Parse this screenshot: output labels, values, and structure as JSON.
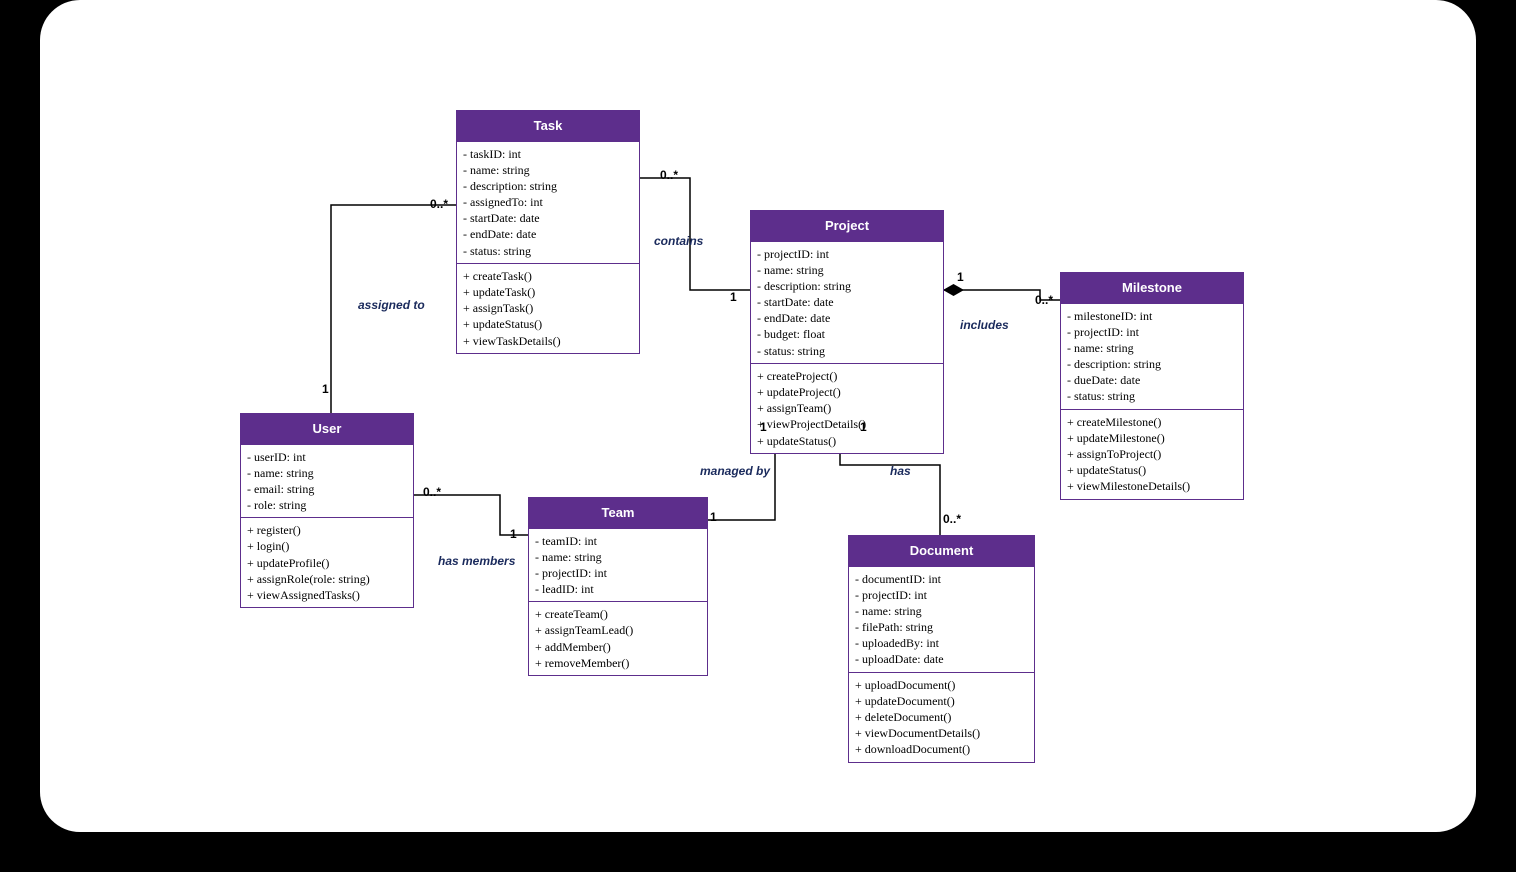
{
  "classes": {
    "task": {
      "title": "Task",
      "attrs": [
        "- taskID: int",
        "- name: string",
        "- description: string",
        "- assignedTo: int",
        "- startDate: date",
        "- endDate: date",
        "- status: string"
      ],
      "ops": [
        "+ createTask()",
        "+ updateTask()",
        "+ assignTask()",
        "+ updateStatus()",
        "+ viewTaskDetails()"
      ]
    },
    "project": {
      "title": "Project",
      "attrs": [
        "- projectID: int",
        "- name: string",
        "- description: string",
        "- startDate: date",
        "- endDate: date",
        "- budget: float",
        "- status: string"
      ],
      "ops": [
        "+ createProject()",
        "+ updateProject()",
        "+ assignTeam()",
        "+ viewProjectDetails()",
        "+ updateStatus()"
      ]
    },
    "milestone": {
      "title": "Milestone",
      "attrs": [
        "- milestoneID: int",
        "- projectID: int",
        "- name: string",
        "- description: string",
        "- dueDate: date",
        "- status: string"
      ],
      "ops": [
        "+ createMilestone()",
        "+ updateMilestone()",
        "+ assignToProject()",
        "+ updateStatus()",
        "+ viewMilestoneDetails()"
      ]
    },
    "user": {
      "title": "User",
      "attrs": [
        "- userID: int",
        "- name: string",
        "- email: string",
        "- role: string"
      ],
      "ops": [
        "+ register()",
        "+ login()",
        "+ updateProfile()",
        "+ assignRole(role: string)",
        "+ viewAssignedTasks()"
      ]
    },
    "team": {
      "title": "Team",
      "attrs": [
        "- teamID: int",
        "- name: string",
        "- projectID: int",
        "- leadID: int"
      ],
      "ops": [
        "+ createTeam()",
        "+ assignTeamLead()",
        "+ addMember()",
        "+ removeMember()"
      ]
    },
    "document": {
      "title": "Document",
      "attrs": [
        "- documentID: int",
        "- projectID: int",
        "- name: string",
        "- filePath: string",
        "- uploadedBy: int",
        "- uploadDate: date"
      ],
      "ops": [
        "+ uploadDocument()",
        "+ updateDocument()",
        "+ deleteDocument()",
        "+ viewDocumentDetails()",
        "+ downloadDocument()"
      ]
    }
  },
  "relations": {
    "assigned_to": {
      "label": "assigned to",
      "m1": "0..*",
      "m2": "1"
    },
    "contains": {
      "label": "contains",
      "m1": "0..*",
      "m2": "1"
    },
    "includes": {
      "label": "includes",
      "m1": "1",
      "m2": "0..*"
    },
    "has_members": {
      "label": "has members",
      "m1": "0..*",
      "m2": "1"
    },
    "managed_by": {
      "label": "managed by",
      "m1": "1",
      "m2": "1"
    },
    "has": {
      "label": "has",
      "m1": "1",
      "m2": "0..*"
    }
  }
}
